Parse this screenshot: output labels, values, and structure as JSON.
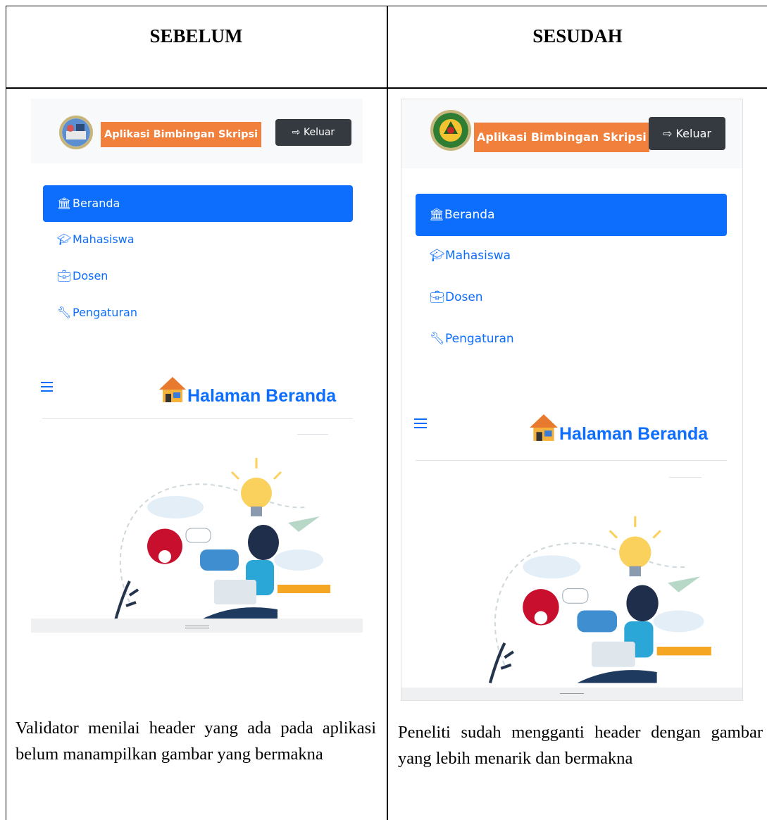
{
  "headers": {
    "before": "SEBELUM",
    "after": "SESUDAH"
  },
  "app": {
    "brand": "Aplikasi Bimbingan Skripsi",
    "logout": "Keluar",
    "nav": [
      "Beranda",
      "Mahasiswa",
      "Dosen",
      "Pengaturan"
    ],
    "page_title": "Halaman Beranda"
  },
  "icons": {
    "home": "bank-icon",
    "students": "graduation-cap-icon",
    "lecturers": "briefcase-icon",
    "settings": "wrench-icon",
    "logout": "sign-out-icon",
    "menu": "hamburger-icon",
    "page": "house-icon"
  },
  "colors": {
    "primary": "#0d6efd",
    "brand_bg": "#f0803c",
    "logout_bg": "#343a40"
  },
  "descriptions": {
    "before": "Validator menilai header yang ada pada aplikasi belum manampilkan gambar yang bermakna",
    "after": "Peneliti sudah mengganti header dengan gambar yang lebih menarik dan bermakna"
  }
}
